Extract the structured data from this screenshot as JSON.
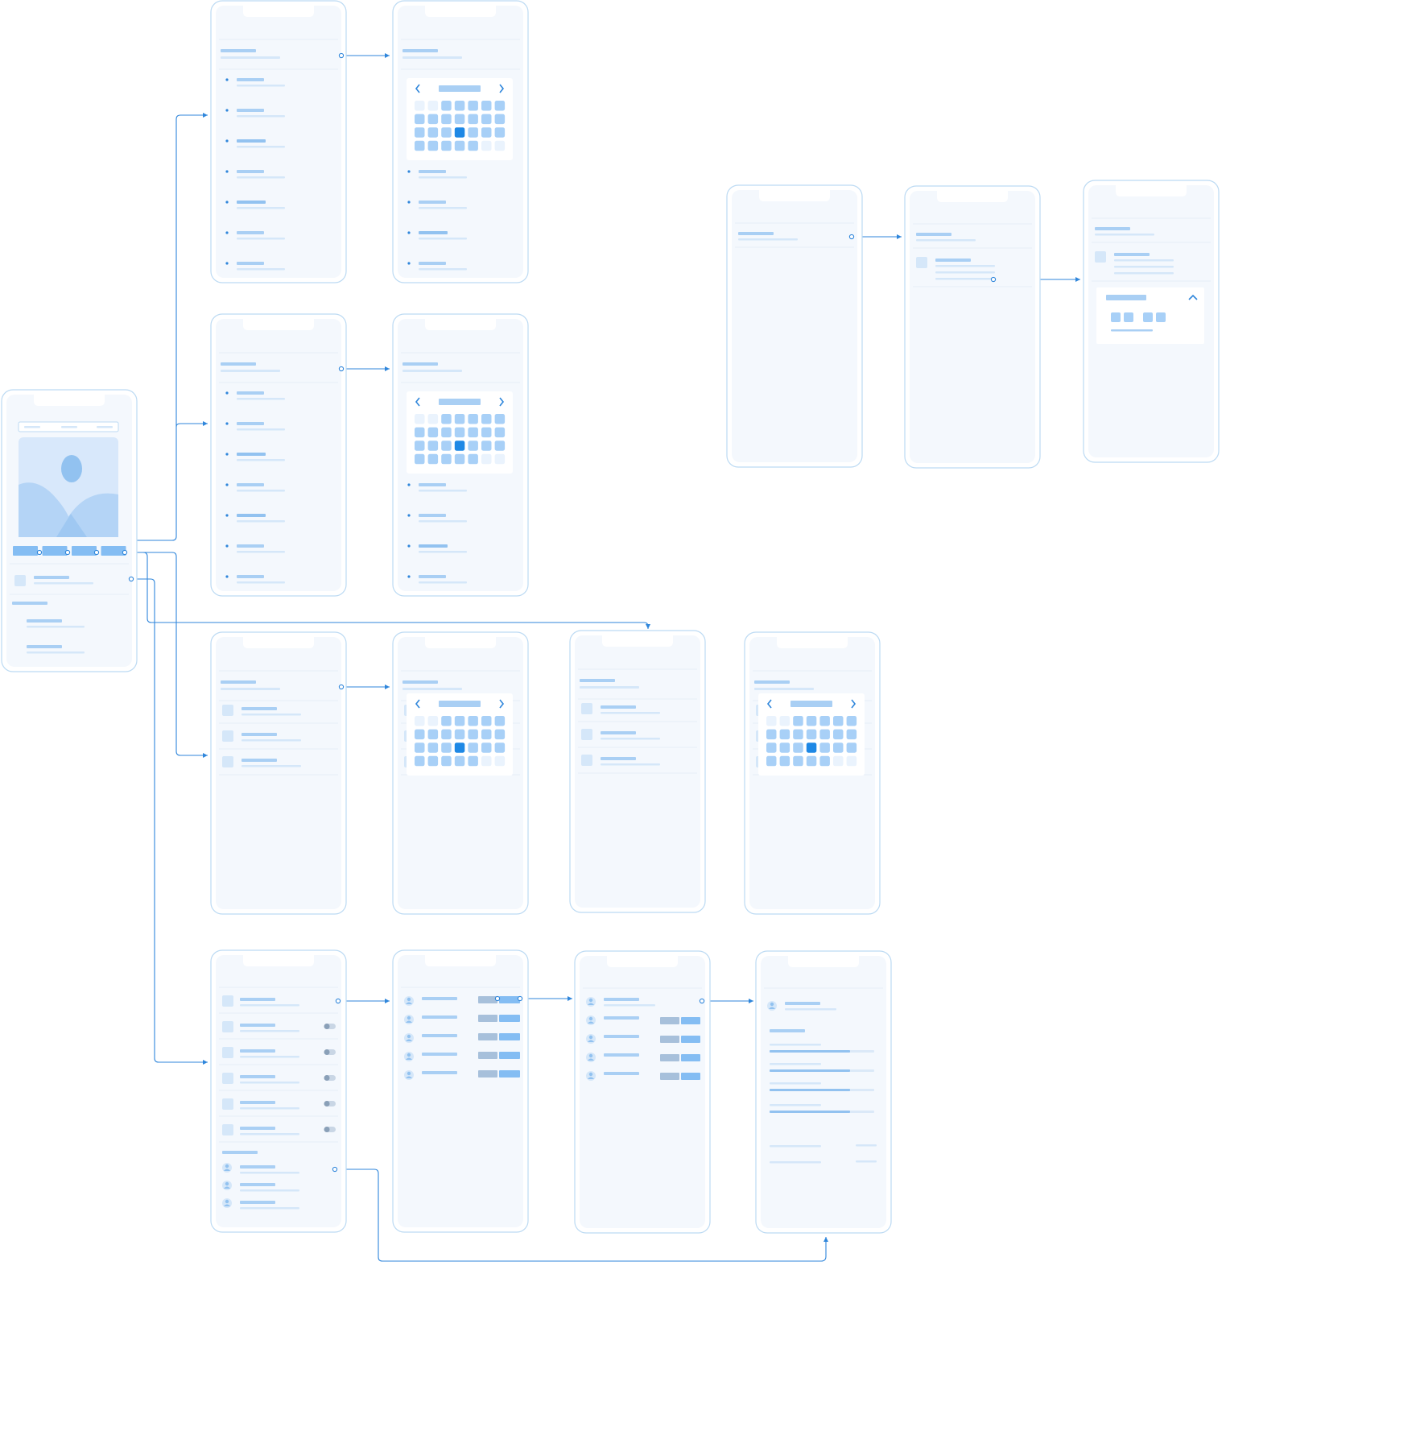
{
  "canvas": {
    "background": "#ffffff",
    "text_content": []
  },
  "palette": {
    "frame_stroke": "#bcdaf3",
    "screen_fill": "#f4f8fd",
    "divider": "#e6eef8",
    "placeholder_dark": "#a9cff4",
    "placeholder_light": "#d5e7f9",
    "placeholder_mid": "#92c2f0",
    "cell_light": "#eaf3fd",
    "cell_mid": "#a8d0f7",
    "selected": "#1e88e5",
    "connector": "#2f86db",
    "grey_button": "#a7c0db",
    "blue_button": "#84bdf3"
  },
  "screens": [
    {
      "id": "home",
      "kind": "home"
    },
    {
      "id": "list-a",
      "kind": "dot-list"
    },
    {
      "id": "calendar-a",
      "kind": "calendar-list"
    },
    {
      "id": "list-b",
      "kind": "dot-list"
    },
    {
      "id": "calendar-b",
      "kind": "calendar-list"
    },
    {
      "id": "items-c",
      "kind": "icon-list"
    },
    {
      "id": "calendar-c",
      "kind": "calendar-only"
    },
    {
      "id": "items-c2",
      "kind": "icon-list"
    },
    {
      "id": "calendar-c2",
      "kind": "calendar-only"
    },
    {
      "id": "settings-d",
      "kind": "toggle-list"
    },
    {
      "id": "users-d",
      "kind": "action-list"
    },
    {
      "id": "users-d2",
      "kind": "action-list"
    },
    {
      "id": "profile-d",
      "kind": "progress"
    },
    {
      "id": "single-e",
      "kind": "single-row"
    },
    {
      "id": "detail-e",
      "kind": "detail"
    },
    {
      "id": "expanded-e",
      "kind": "expand-panel"
    }
  ],
  "connections": [
    {
      "from": "home",
      "to": "list-a"
    },
    {
      "from": "home",
      "to": "list-b"
    },
    {
      "from": "home",
      "to": "items-c"
    },
    {
      "from": "home",
      "to": "settings-d"
    },
    {
      "from": "home",
      "to": "items-c2"
    },
    {
      "from": "list-a",
      "to": "calendar-a"
    },
    {
      "from": "list-b",
      "to": "calendar-b"
    },
    {
      "from": "items-c",
      "to": "calendar-c"
    },
    {
      "from": "settings-d",
      "to": "users-d"
    },
    {
      "from": "users-d",
      "to": "users-d2"
    },
    {
      "from": "users-d2",
      "to": "profile-d"
    },
    {
      "from": "settings-d",
      "to": "profile-d"
    },
    {
      "from": "single-e",
      "to": "detail-e"
    },
    {
      "from": "detail-e",
      "to": "expanded-e"
    }
  ]
}
